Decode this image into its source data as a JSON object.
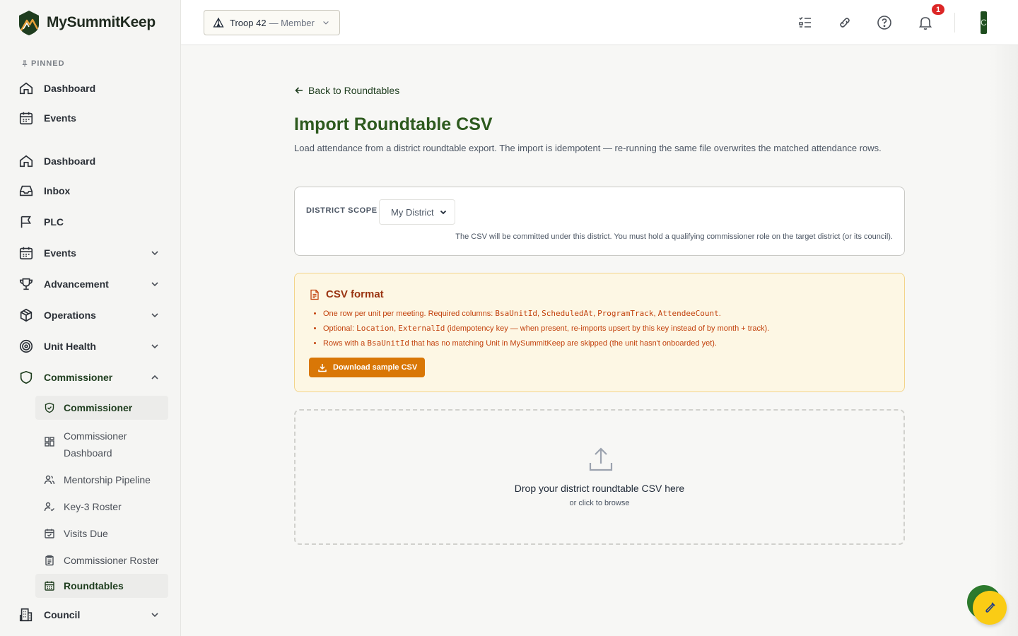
{
  "brand": {
    "name": "MySummitKeep"
  },
  "sidebar": {
    "pinned_label": "PINNED",
    "pinned": [
      {
        "label": "Dashboard",
        "icon": "home-icon"
      },
      {
        "label": "Events",
        "icon": "calendar-icon"
      }
    ],
    "items": [
      {
        "label": "Dashboard",
        "icon": "home-icon"
      },
      {
        "label": "Inbox",
        "icon": "inbox-icon"
      },
      {
        "label": "PLC",
        "icon": "flag-icon"
      },
      {
        "label": "Events",
        "icon": "calendar-icon",
        "expanded": false
      },
      {
        "label": "Advancement",
        "icon": "trophy-icon",
        "expanded": false
      },
      {
        "label": "Operations",
        "icon": "box-icon",
        "expanded": false
      },
      {
        "label": "Unit Health",
        "icon": "target-icon",
        "expanded": false
      },
      {
        "label": "Commissioner",
        "icon": "shield-icon",
        "expanded": true
      },
      {
        "label": "Council",
        "icon": "building-icon",
        "expanded": false
      }
    ],
    "commissioner_sub": [
      {
        "label": "Commissioner",
        "icon": "shield-check-icon",
        "active": false
      },
      {
        "label": "Commissioner Dashboard",
        "icon": "grid-icon",
        "active": false
      },
      {
        "label": "Mentorship Pipeline",
        "icon": "users-icon",
        "active": false
      },
      {
        "label": "Key-3 Roster",
        "icon": "user-check-icon",
        "active": false
      },
      {
        "label": "Visits Due",
        "icon": "calendar-check-icon",
        "active": false
      },
      {
        "label": "Commissioner Roster",
        "icon": "clipboard-icon",
        "active": false
      },
      {
        "label": "Roundtables",
        "icon": "calendar-grid-icon",
        "active": true
      }
    ]
  },
  "topbar": {
    "unit_name": "Troop 42",
    "unit_role": "— Member",
    "notifications_count": "1",
    "avatar_initial": "C"
  },
  "main": {
    "back_label": "Back to Roundtables",
    "title": "Import Roundtable CSV",
    "description": "Load attendance from a district roundtable export. The import is idempotent — re-running the same file overwrites the matched attendance rows.",
    "scope": {
      "label": "DISTRICT SCOPE",
      "selected": "My District",
      "help": "The CSV will be committed under this district. You must hold a qualifying commissioner role on the target district (or its council)."
    },
    "csv_format": {
      "title": "CSV format",
      "line1_prefix": "One row per unit per meeting. Required columns: ",
      "line1_cols": [
        "BsaUnitId",
        "ScheduledAt",
        "ProgramTrack",
        "AttendeeCount"
      ],
      "line2_prefix": "Optional: ",
      "line2_cols": [
        "Location",
        "ExternalId"
      ],
      "line2_suffix": " (idempotency key — when present, re-imports upsert by this key instead of by month + track).",
      "line3_prefix": "Rows with a ",
      "line3_col": "BsaUnitId",
      "line3_suffix": " that has no matching Unit in MySummitKeep are skipped (the unit hasn't onboarded yet).",
      "download_label": "Download sample CSV"
    },
    "dropzone": {
      "title": "Drop your district roundtable CSV here",
      "subtitle": "or click to browse"
    }
  },
  "colors": {
    "brand_green": "#2d5a1e",
    "warning_bg": "#fdf7e4",
    "warning_text": "#c2410c",
    "download_button": "#d97706",
    "badge": "#dc2626",
    "fab": "#facc15"
  }
}
